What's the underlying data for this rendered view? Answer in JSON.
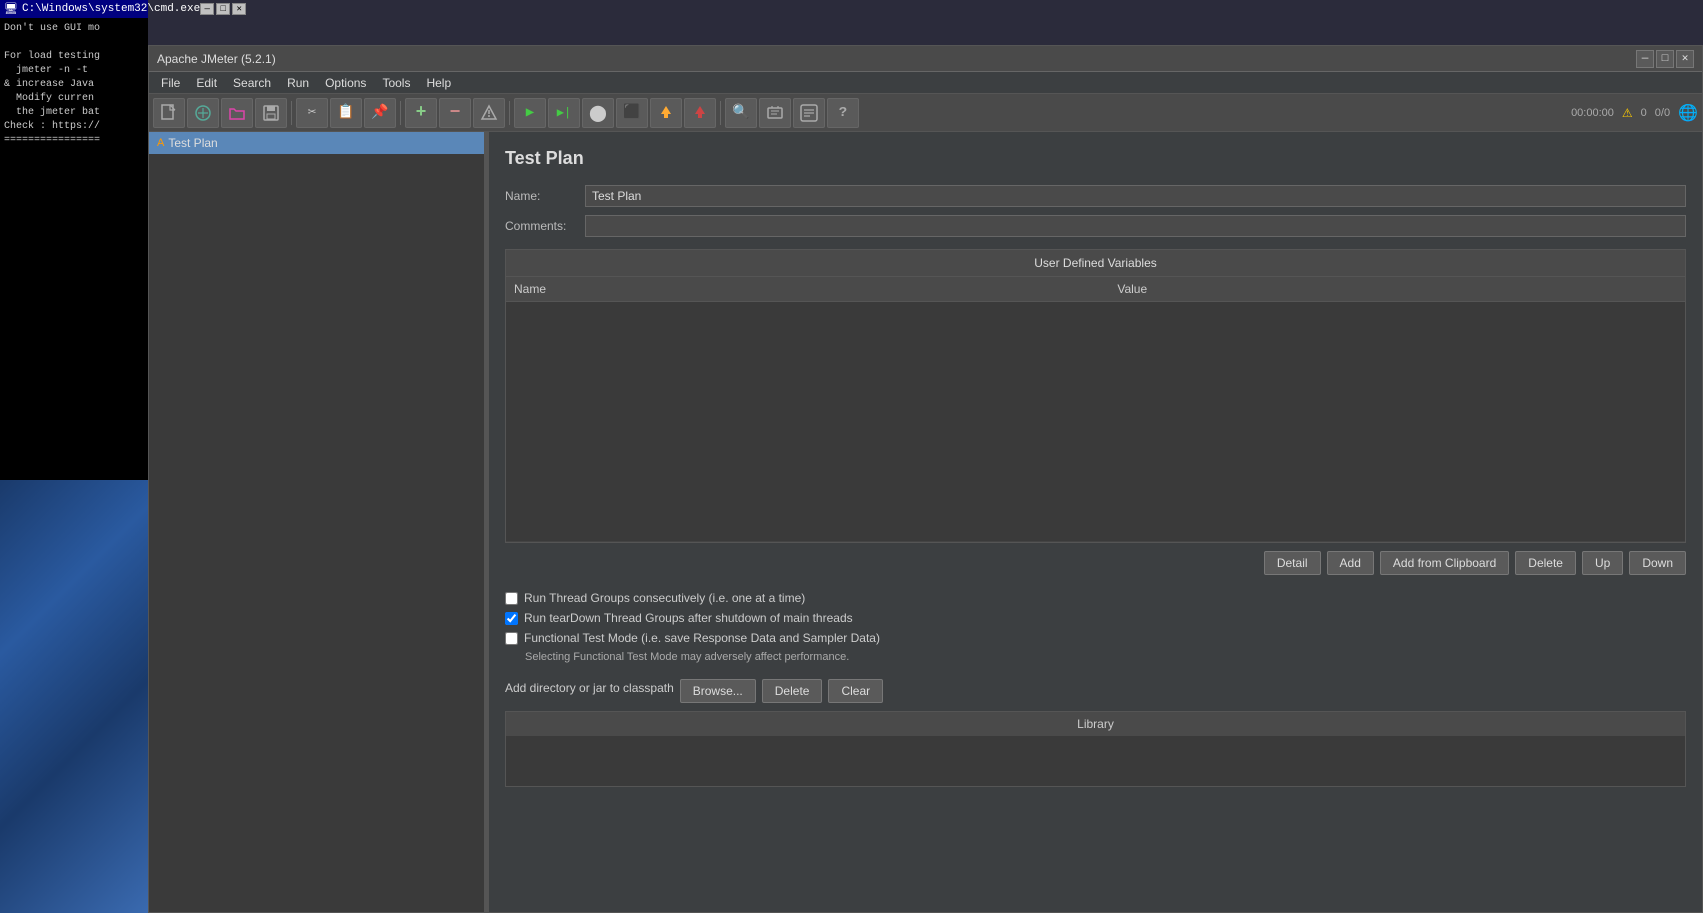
{
  "cmd_window": {
    "title": "C:\\Windows\\system32\\cmd.exe",
    "content_lines": [
      "Don't use GUI mo",
      "",
      "For load testing",
      "  jmeter -n -t",
      "& increase Java",
      "  Modify curren",
      "  the jmeter bat",
      "Check : https://",
      "================="
    ]
  },
  "jmeter_window": {
    "title": "Apache JMeter (5.2.1)",
    "titlebar_buttons": [
      "—",
      "□",
      "✕"
    ]
  },
  "menubar": {
    "items": [
      "File",
      "Edit",
      "Search",
      "Run",
      "Options",
      "Tools",
      "Help"
    ]
  },
  "toolbar": {
    "buttons": [
      {
        "icon": "📄",
        "name": "new"
      },
      {
        "icon": "🌐",
        "name": "templates"
      },
      {
        "icon": "📂",
        "name": "open"
      },
      {
        "icon": "💾",
        "name": "save"
      },
      {
        "icon": "✂",
        "name": "cut"
      },
      {
        "icon": "📋",
        "name": "copy"
      },
      {
        "icon": "📌",
        "name": "paste"
      },
      {
        "icon": "+",
        "name": "add"
      },
      {
        "icon": "−",
        "name": "remove"
      },
      {
        "icon": "✏",
        "name": "toggle"
      },
      {
        "icon": "▶",
        "name": "start"
      },
      {
        "icon": "▶|",
        "name": "start-no-pauses"
      },
      {
        "icon": "⬤",
        "name": "start-remote"
      },
      {
        "icon": "⬛",
        "name": "stop"
      },
      {
        "icon": "🚩",
        "name": "shutdown"
      },
      {
        "icon": "🚩",
        "name": "stop-remote"
      },
      {
        "icon": "🔍",
        "name": "search"
      },
      {
        "icon": "↩",
        "name": "clear"
      },
      {
        "icon": "📋",
        "name": "function-helper"
      },
      {
        "icon": "?",
        "name": "help"
      }
    ],
    "right": {
      "time": "00:00:00",
      "warning_count": "0",
      "error_count": "0/0"
    }
  },
  "tree": {
    "items": [
      {
        "label": "Test Plan",
        "icon": "A",
        "selected": true
      }
    ]
  },
  "test_plan": {
    "title": "Test Plan",
    "name_label": "Name:",
    "name_value": "Test Plan",
    "comments_label": "Comments:",
    "comments_value": "",
    "udv": {
      "section_title": "User Defined Variables",
      "columns": [
        "Name",
        "Value"
      ],
      "rows": []
    },
    "udv_buttons": {
      "detail": "Detail",
      "add": "Add",
      "add_from_clipboard": "Add from Clipboard",
      "delete": "Delete",
      "up": "Up",
      "down": "Down"
    },
    "checkboxes": [
      {
        "label": "Run Thread Groups consecutively (i.e. one at a time)",
        "checked": false
      },
      {
        "label": "Run tearDown Thread Groups after shutdown of main threads",
        "checked": true
      },
      {
        "label": "Functional Test Mode (i.e. save Response Data and Sampler Data)",
        "checked": false
      }
    ],
    "functional_note": "Selecting Functional Test Mode may adversely affect performance.",
    "classpath": {
      "label": "Add directory or jar to classpath",
      "browse_btn": "Browse...",
      "delete_btn": "Delete",
      "clear_btn": "Clear"
    },
    "library": {
      "header": "Library"
    }
  }
}
